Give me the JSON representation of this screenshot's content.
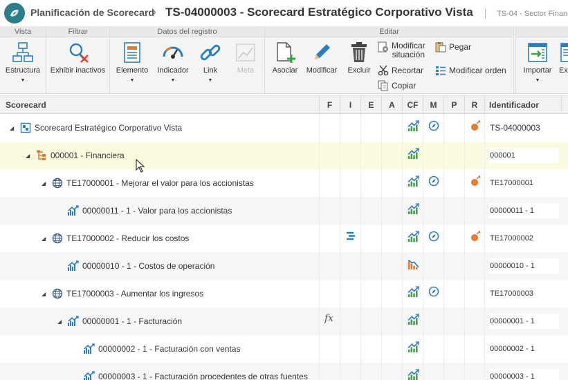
{
  "app": {
    "breadcrumb": "Planificación de Scorecard",
    "separator": "›",
    "title": "TS-04000003 - Scorecard Estratégico Corporativo Vista",
    "subtitle": "TS-04 - Sector Financ"
  },
  "ribbon": {
    "groups": {
      "vista": "Vista",
      "filtrar": "Filtrar",
      "datos": "Datos del registro",
      "editar": "Editar"
    },
    "buttons": {
      "estructura": "Estructura",
      "exhibir_inactivos": "Exhibir inactivos",
      "elemento": "Elemento",
      "indicador": "Indicador",
      "link": "Link",
      "meta": "Meta",
      "asociar": "Asociar",
      "modificar": "Modificar",
      "excluir": "Excluir",
      "modificar_situacion_1": "Modificar",
      "modificar_situacion_2": "situación",
      "recortar": "Recortar",
      "copiar": "Copiar",
      "pegar": "Pegar",
      "modificar_orden": "Modificar orden",
      "importar": "Importar",
      "exportar_partial": "Ex"
    }
  },
  "grid": {
    "columns": [
      "Scorecard",
      "F",
      "I",
      "E",
      "A",
      "CF",
      "M",
      "P",
      "R",
      "Identificador"
    ],
    "rows": [
      {
        "level": 0,
        "label": "Scorecard Estratégico Corporativo Vista",
        "icon": "scorecard-icon",
        "expander": "◢",
        "f": "",
        "i": "",
        "cf": "trend-icon",
        "m": "compass-icon",
        "r": "risk-icon",
        "id": "TS-04000003",
        "id_style": "plain"
      },
      {
        "level": 1,
        "label": "000001 - Financiera",
        "icon": "perspective-icon",
        "expander": "◢",
        "f": "",
        "i": "",
        "cf": "trend-icon",
        "m": "",
        "r": "",
        "id": "000001",
        "id_style": "box"
      },
      {
        "level": 2,
        "label": "TE17000001 - Mejorar el valor para los accionistas",
        "icon": "globe-icon",
        "expander": "◢",
        "f": "",
        "i": "",
        "cf": "trend-icon",
        "m": "compass-icon",
        "r": "risk-icon",
        "id": "TE17000001",
        "id_style": "box"
      },
      {
        "level": 3,
        "label": "00000011 - 1 - Valor para los accionistas",
        "icon": "indicator-icon",
        "expander": "",
        "f": "",
        "i": "",
        "cf": "trend-icon",
        "m": "",
        "r": "",
        "id": "00000011 - 1",
        "id_style": "box"
      },
      {
        "level": 2,
        "label": "TE17000002 - Reducir los costos",
        "icon": "globe-icon",
        "expander": "◢",
        "f": "",
        "i": "list-icon",
        "cf": "trend-icon",
        "m": "compass-icon",
        "r": "risk-icon",
        "id": "TE17000002",
        "id_style": "box"
      },
      {
        "level": 3,
        "label": "00000010 - 1 - Costos de operación",
        "icon": "indicator-icon",
        "expander": "",
        "f": "",
        "i": "",
        "cf": "trend-down-icon",
        "m": "",
        "r": "",
        "id": "00000010 - 1",
        "id_style": "box"
      },
      {
        "level": 2,
        "label": "TE17000003 - Aumentar los ingresos",
        "icon": "globe-icon",
        "expander": "◢",
        "f": "",
        "i": "",
        "cf": "trend-icon",
        "m": "compass-icon",
        "r": "",
        "id": "TE17000003",
        "id_style": "box"
      },
      {
        "level": 3,
        "label": "00000001 - 1 - Facturación",
        "icon": "indicator-icon",
        "expander": "◢",
        "f": "fx",
        "i": "",
        "cf": "trend-icon",
        "m": "",
        "r": "",
        "id": "00000001 - 1",
        "id_style": "box"
      },
      {
        "level": 4,
        "label": "00000002 - 1 - Facturación con ventas",
        "icon": "indicator-icon",
        "expander": "",
        "f": "",
        "i": "",
        "cf": "trend-icon",
        "m": "",
        "r": "",
        "id": "00000002 - 1",
        "id_style": "box"
      },
      {
        "level": 4,
        "label": "00000003 - 1 - Facturación procedentes de otras fuentes",
        "icon": "indicator-icon",
        "expander": "",
        "f": "",
        "i": "",
        "cf": "trend-icon",
        "m": "",
        "r": "",
        "id": "00000003 - 1",
        "id_style": "box"
      }
    ]
  },
  "colors": {
    "accent": "#2e7d8a",
    "blue_icon": "#2a7fc1",
    "orange_icon": "#e8792b",
    "green_trend": "#3aa346",
    "selected_row": "#fbfbdf"
  }
}
